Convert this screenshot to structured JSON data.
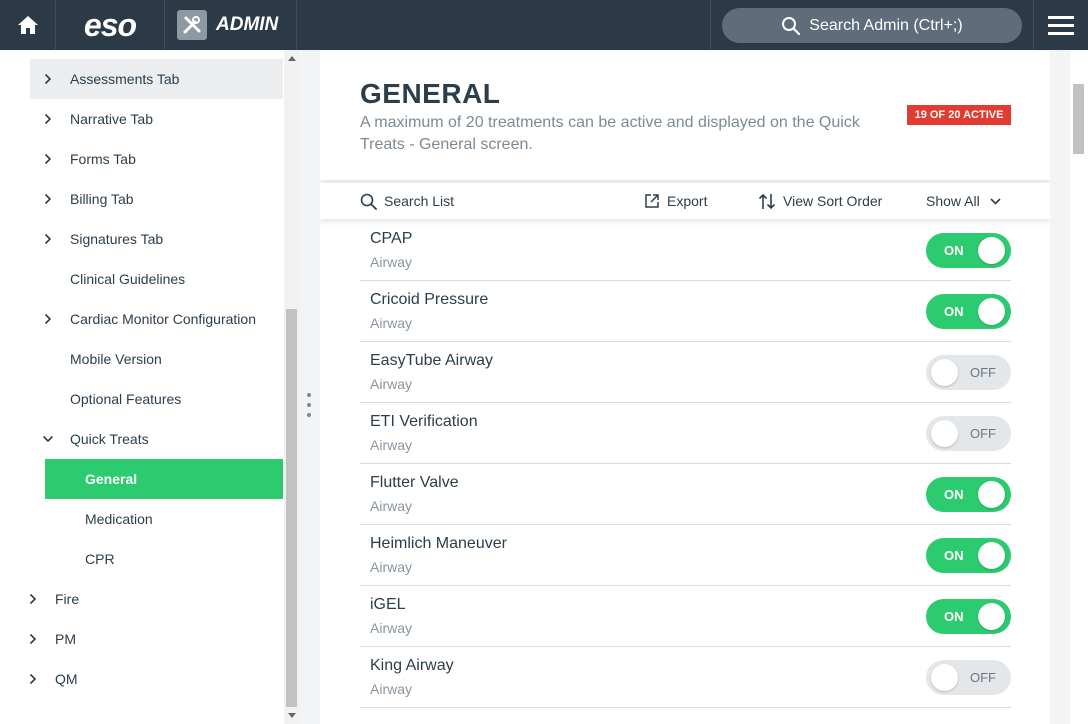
{
  "topbar": {
    "logo": "eso",
    "section": "ADMIN",
    "search_label": "Search Admin (Ctrl+;)"
  },
  "sidebar": {
    "items": [
      {
        "label": "Assessments Tab",
        "chevron": "right"
      },
      {
        "label": "Narrative Tab",
        "chevron": "right"
      },
      {
        "label": "Forms Tab",
        "chevron": "right"
      },
      {
        "label": "Billing Tab",
        "chevron": "right"
      },
      {
        "label": "Signatures Tab",
        "chevron": "right"
      },
      {
        "label": "Clinical Guidelines",
        "chevron": ""
      },
      {
        "label": "Cardiac Monitor Configuration",
        "chevron": "right"
      },
      {
        "label": "Mobile Version",
        "chevron": ""
      },
      {
        "label": "Optional Features",
        "chevron": ""
      },
      {
        "label": "Quick Treats",
        "chevron": "down"
      },
      {
        "label": "General",
        "chevron": "",
        "selected": true
      },
      {
        "label": "Medication",
        "chevron": ""
      },
      {
        "label": "CPR",
        "chevron": ""
      },
      {
        "label": "Fire",
        "chevron": "right"
      },
      {
        "label": "PM",
        "chevron": "right"
      },
      {
        "label": "QM",
        "chevron": "right"
      }
    ]
  },
  "main": {
    "title": "GENERAL",
    "description": "A maximum of 20 treatments can be active and displayed on the Quick Treats - General screen.",
    "badge": "19 OF 20 ACTIVE",
    "toolbar": {
      "search": "Search List",
      "export": "Export",
      "sort": "View Sort Order",
      "filter": "Show All"
    },
    "rows": [
      {
        "name": "CPAP",
        "category": "Airway",
        "state": "ON"
      },
      {
        "name": "Cricoid Pressure",
        "category": "Airway",
        "state": "ON"
      },
      {
        "name": "EasyTube Airway",
        "category": "Airway",
        "state": "OFF"
      },
      {
        "name": "ETI Verification",
        "category": "Airway",
        "state": "OFF"
      },
      {
        "name": "Flutter Valve",
        "category": "Airway",
        "state": "ON"
      },
      {
        "name": "Heimlich Maneuver",
        "category": "Airway",
        "state": "ON"
      },
      {
        "name": "iGEL",
        "category": "Airway",
        "state": "ON"
      },
      {
        "name": "King Airway",
        "category": "Airway",
        "state": "OFF"
      }
    ]
  },
  "colors": {
    "topbar": "#2b3a46",
    "accent_green": "#2dcb6f",
    "badge_red": "#e03c31",
    "text": "#2d3e4a"
  }
}
